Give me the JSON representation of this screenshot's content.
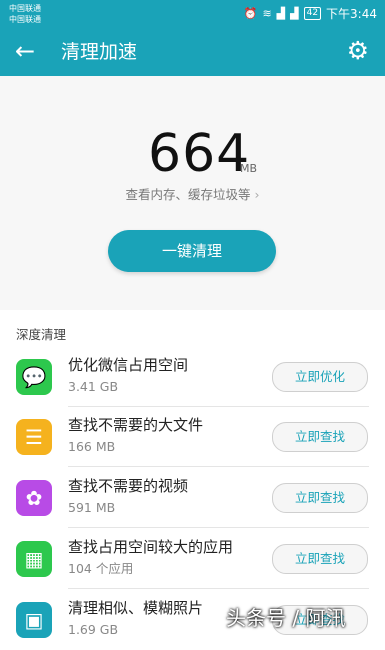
{
  "status_bar": {
    "carrier_1": "中国联通",
    "carrier_2": "中国联通",
    "battery": "42",
    "time": "下午3:44"
  },
  "header": {
    "title": "清理加速",
    "back_icon": "arrow-left-icon",
    "settings_icon": "gear-icon"
  },
  "summary": {
    "value": "664",
    "unit": "MB",
    "subtitle": "查看内存、缓存垃圾等",
    "button": "一键清理"
  },
  "section_title": "深度清理",
  "items": [
    {
      "name": "优化微信占用空间",
      "size": "3.41 GB",
      "action": "立即优化",
      "icon": "wechat-icon",
      "color": "#2dc84d"
    },
    {
      "name": "查找不需要的大文件",
      "size": "166 MB",
      "action": "立即查找",
      "icon": "document-icon",
      "color": "#f5b21e"
    },
    {
      "name": "查找不需要的视频",
      "size": "591 MB",
      "action": "立即查找",
      "icon": "video-reel-icon",
      "color": "#b84be6"
    },
    {
      "name": "查找占用空间较大的应用",
      "size": "104 个应用",
      "action": "立即查找",
      "icon": "apps-grid-icon",
      "color": "#2dc84d"
    },
    {
      "name": "清理相似、模糊照片",
      "size": "1.69 GB",
      "action": "立即查找",
      "icon": "photo-icon",
      "color": "#1aa3b8"
    }
  ],
  "watermark": "头条号 / 阿汛",
  "accent": "#1aa3b8"
}
